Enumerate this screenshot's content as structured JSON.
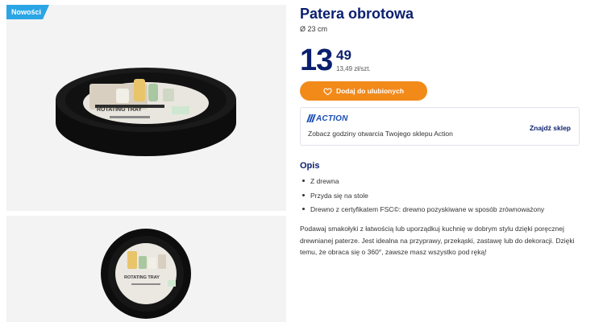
{
  "badge": {
    "label": "Nowości"
  },
  "images": {
    "main_alt": "ROTATING TRAY",
    "second_alt": "ROTATING TRAY"
  },
  "product": {
    "title": "Patera obrotowa",
    "size": "Ø 23 cm",
    "price_int": "13",
    "price_dec": "49",
    "price_unit": "13,49 zł/szt."
  },
  "favorite_button": {
    "label": "Dodaj do ulubionych",
    "icon": "heart-icon"
  },
  "store": {
    "logo_text": "ACTION",
    "text": "Zobacz godziny otwarcia Twojego sklepu Action",
    "link": "Znajdź sklep"
  },
  "description": {
    "title": "Opis",
    "bullets": [
      "Z drewna",
      "Przyda się na stole",
      "Drewno z certyfikatem FSC©: drewno pozyskiwane w sposób zrównoważony"
    ],
    "text": "Podawaj smakołyki z łatwością lub uporządkuj kuchnię w dobrym stylu dzięki poręcznej drewnianej paterze. Jest idealna na przyprawy, przekąski, zastawę lub do dekoracji. Dzięki temu, że obraca się o 360°, zawsze masz wszystko pod ręką!"
  },
  "colors": {
    "brand_blue": "#0a1f6e",
    "badge_blue": "#2aa5e6",
    "button_orange": "#f28a1a",
    "logo_blue": "#1b4db3"
  }
}
